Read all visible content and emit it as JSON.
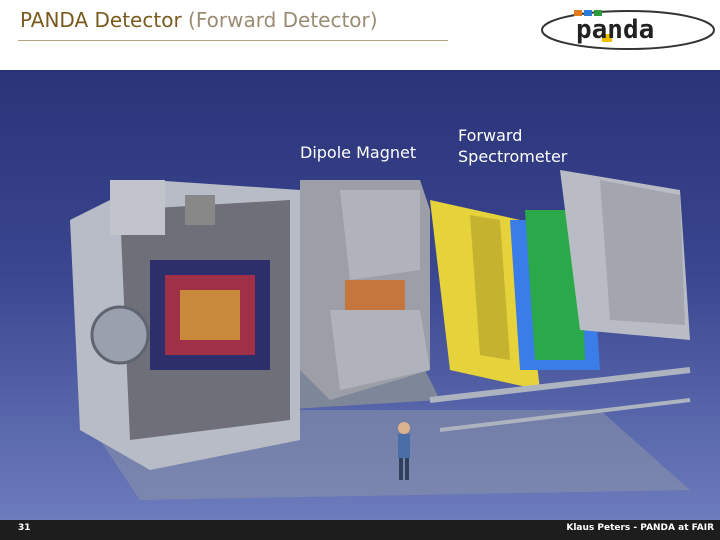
{
  "slide": {
    "title_main": "PANDA Detector",
    "title_sub": "(Forward Detector)"
  },
  "logo": {
    "text": "panda"
  },
  "figure": {
    "label_dipole": "Dipole Magnet",
    "label_forward_line1": "Forward",
    "label_forward_line2": "Spectrometer"
  },
  "footer": {
    "page_number": "31",
    "credit": "Klaus Peters - PANDA at FAIR"
  },
  "colors": {
    "title": "#7a5a1e",
    "background_top": "#2b3378",
    "background_bottom": "#6d7cbd",
    "footer": "#1d1d1d"
  }
}
